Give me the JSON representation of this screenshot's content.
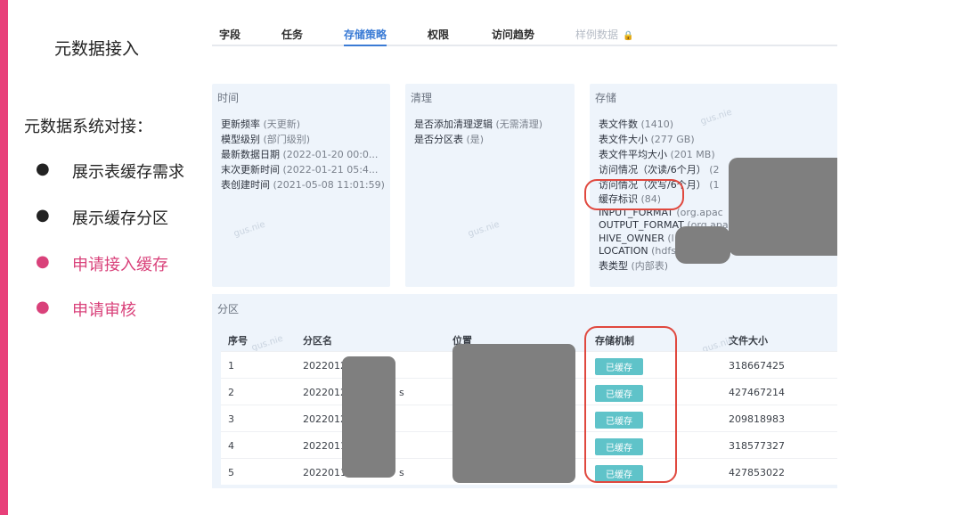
{
  "slide": {
    "title": "元数据接入",
    "heading": "元数据系统对接：",
    "bullets": [
      {
        "dot": "●",
        "text": "展示表缓存需求"
      },
      {
        "dot": "●",
        "text": "展示缓存分区"
      },
      {
        "dot": "●",
        "text": "申请接入缓存"
      },
      {
        "dot": "●",
        "text": "申请审核"
      }
    ]
  },
  "tabs": [
    "字段",
    "任务",
    "存储策略",
    "权限",
    "访问趋势",
    "样例数据"
  ],
  "lock_glyph": "🔒",
  "watermark": "gus.nie",
  "time_card": {
    "title": "时间",
    "lines": [
      {
        "label": "更新频率",
        "value": "(天更新)"
      },
      {
        "label": "模型级别",
        "value": "(部门级别)"
      },
      {
        "label": "最新数据日期",
        "value": "(2022-01-20 00:0..."
      },
      {
        "label": "末次更新时间",
        "value": "(2022-01-21 05:4..."
      },
      {
        "label": "表创建时间",
        "value": "(2021-05-08 11:01:59)"
      }
    ]
  },
  "clean_card": {
    "title": "清理",
    "lines": [
      {
        "label": "是否添加清理逻辑",
        "value": "(无需清理)"
      },
      {
        "label": "是否分区表",
        "value": "(是)"
      }
    ]
  },
  "storage_card": {
    "title": "存储",
    "lines": [
      {
        "label": "表文件数",
        "value": "(1410)"
      },
      {
        "label": "表文件大小",
        "value": "(277 GB)"
      },
      {
        "label": "表文件平均大小",
        "value": "(201 MB)"
      },
      {
        "label": "访问情况（次读/6个月）",
        "value": "(2"
      },
      {
        "label": "访问情况（次写/6个月）",
        "value": "(1"
      },
      {
        "label": "缓存标识",
        "value": "(84)"
      },
      {
        "label": "INPUT_FORMAT",
        "value": "(org.apac"
      },
      {
        "label": "OUTPUT_FORMAT",
        "value": "(org.apa"
      },
      {
        "label": "HIVE_OWNER",
        "value": "(l"
      },
      {
        "label": "LOCATION",
        "value": "(hdfs"
      },
      {
        "label": "表类型",
        "value": "(内部表)"
      }
    ]
  },
  "partition": {
    "title": "分区",
    "headers": [
      "序号",
      "分区名",
      "位置",
      "存储机制",
      "文件大小"
    ],
    "rows": [
      {
        "index": "1",
        "name": "2022012",
        "tail": "",
        "badge": "已缓存",
        "size": "318667425"
      },
      {
        "index": "2",
        "name": "2022012",
        "tail": "s",
        "badge": "已缓存",
        "size": "427467214"
      },
      {
        "index": "3",
        "name": "2022012",
        "tail": "",
        "badge": "已缓存",
        "size": "209818983"
      },
      {
        "index": "4",
        "name": "2022011",
        "tail": "",
        "badge": "已缓存",
        "size": "318577327"
      },
      {
        "index": "5",
        "name": "2022011",
        "tail": "s",
        "badge": "已缓存",
        "size": "427853022"
      }
    ]
  },
  "colors": {
    "accent": "#3a7bd5",
    "badge": "#5fc3c9",
    "highlight": "#e0483e",
    "pink": "#e8407a"
  }
}
